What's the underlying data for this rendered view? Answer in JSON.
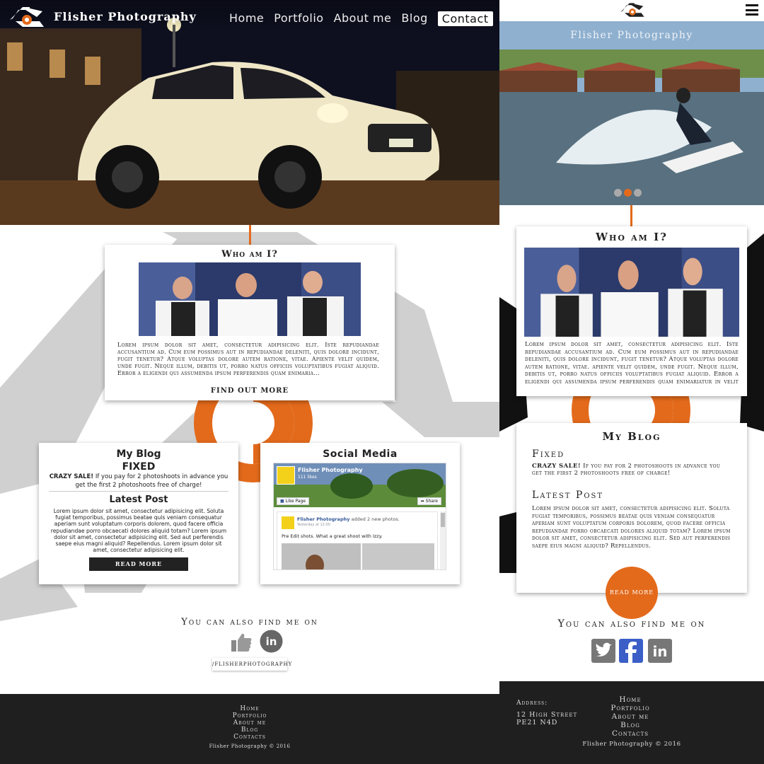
{
  "colors": {
    "accent": "#e36a1b",
    "dark": "#1f1f1f",
    "grey": "#cfcfcf"
  },
  "desktop": {
    "brand": "Flisher Photography",
    "nav": [
      {
        "label": "Home"
      },
      {
        "label": "Portfolio"
      },
      {
        "label": "About me"
      },
      {
        "label": "Blog"
      },
      {
        "label": "Contact"
      }
    ],
    "about": {
      "title": "Who am I?",
      "text": "Lorem ipsum dolor sit amet, consectetur adipisicing elit. Iste repudiandae accusantium ad. Cum eum possimus aut in repudiandae deleniti, quis dolore incidunt, fugit tenetur? Atque voluptas dolore autem ratione, vitae. Apiente velit quidem, unde fugit. Neque illum, debitis ut, porro natus officiis voluptatibus fugiat aliquid. Error a eligendi qui assumenda ipsum perferendis quam enimaria...",
      "button": "FIND OUT MORE"
    },
    "blog": {
      "title": "My Blog",
      "fixed": "FIXED",
      "sale_bold": "CRAZY SALE!",
      "sale_text": " If you pay for 2 photoshoots in advance you get the first 2 photoshoots free of charge!",
      "latest": "Latest Post",
      "text": "Lorem ipsum dolor sit amet, consectetur adipisicing elit. Soluta fugiat temporibus, possimus beatae quis veniam consequatur aperiam sunt voluptatum corporis dolorem, quod facere officia repudiandae porro obcaecati dolores aliquid totam? Lorem ipsum dolor sit amet, consectetur adipisicing elit. Sed aut perferendis saepe eius magni aliquid? Repellendus. Lorem ipsum dolor sit amet, consectetur adipisicing elit.",
      "button": "READ MORE"
    },
    "social": {
      "title": "Social Media",
      "fb_page": "Flisher Photography",
      "fb_likes": "111 likes",
      "like_btn": "Like Page",
      "share_btn": "Share",
      "post_name": "Flisher Photography",
      "post_action": " added 2 new photos.",
      "post_time": "Yesterday at 12:00",
      "post_text": "Pre Edit shots. What a great shoot with Izzy."
    },
    "find": "You can also find me on",
    "handle": "/FLISHERPHOTOGRAPHY",
    "footer": {
      "links": [
        "Home",
        "Portfolio",
        "About me",
        "Blog",
        "Contacts"
      ],
      "copyright": "Flisher Photography © 2016"
    }
  },
  "mobile": {
    "brand": "Flisher Photography",
    "about": {
      "title": "Who am I?",
      "text": "Lorem ipsum dolor sit amet, consectetur adipisicing elit. Iste repudiandae accusantium ad. Cum eum possimus aut in repudiandae deleniti, quis dolore incidunt, fugit tenetur? Atque voluptas dolore autem ratione, vitae. apiente velit quidem, unde fugit. Neque illum, debitis ut, porro natus officiis voluptatibus fugiat aliquid. Error a eligendi qui assumenda ipsum perferendis quam enimariatur in velit asperna-"
    },
    "blog": {
      "title": "My Blog",
      "fixed": "Fixed",
      "sale_bold": "CRAZY SALE!",
      "sale_text": " If you pay for 2 photoshoots in advance you get the first 2 photoshoots free of charge!",
      "latest": "Latest Post",
      "text": "Lorem ipsum dolor sit amet, consectetur adipisicing elit. Soluta fugiat temporibus, possimus beatae quis veniam consequatur aperiam sunt voluptatum corporis dolorem, quod facere officia repudiandae porro obcaecati dolores aliquid totam? Lorem ipsum dolor sit amet, consectetur adipisicing elit. Sed aut perferendis saepe eius magni aliquid? Repellendus.",
      "button": "READ MORE"
    },
    "find": "You can also find me on",
    "footer": {
      "address_label": "Address:",
      "address_line1": "12 High Street",
      "address_line2": "PE21 N4D",
      "links": [
        "Home",
        "Portfolio",
        "About me",
        "Blog",
        "Contacts"
      ],
      "copyright": "Flisher Photography © 2016"
    }
  }
}
